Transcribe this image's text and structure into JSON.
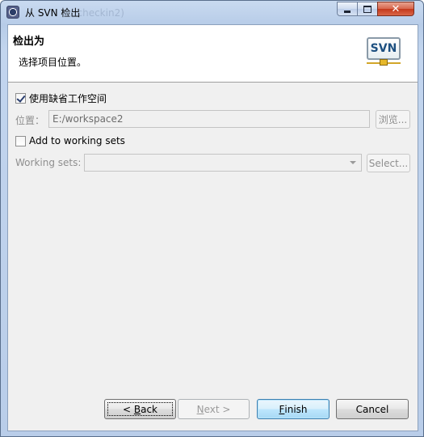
{
  "window": {
    "title": "从 SVN 检出",
    "title_ghost": "(.checkin2)"
  },
  "header": {
    "title": "检出为",
    "description": "选择项目位置。",
    "logo_text": "SVN"
  },
  "form": {
    "use_default_workspace": {
      "label": "使用缺省工作空间",
      "checked": true
    },
    "location": {
      "label": "位置：",
      "value": "E:/workspace2",
      "browse_label": "浏览..."
    },
    "add_to_working_sets": {
      "label": "Add to working sets",
      "checked": false
    },
    "working_sets": {
      "label": "Working sets:",
      "value": "",
      "select_label": "Select..."
    }
  },
  "buttons": {
    "back": {
      "prefix": "< ",
      "mnemonic": "B",
      "rest": "ack"
    },
    "next": {
      "mnemonic": "N",
      "rest": "ext >"
    },
    "finish": {
      "mnemonic": "F",
      "rest": "inish"
    },
    "cancel": "Cancel"
  },
  "colors": {
    "frame": "#b9cde9",
    "client_bg": "#f0f0f0",
    "focus_blue": "#3c7fb1",
    "close_red": "#c4381b"
  }
}
